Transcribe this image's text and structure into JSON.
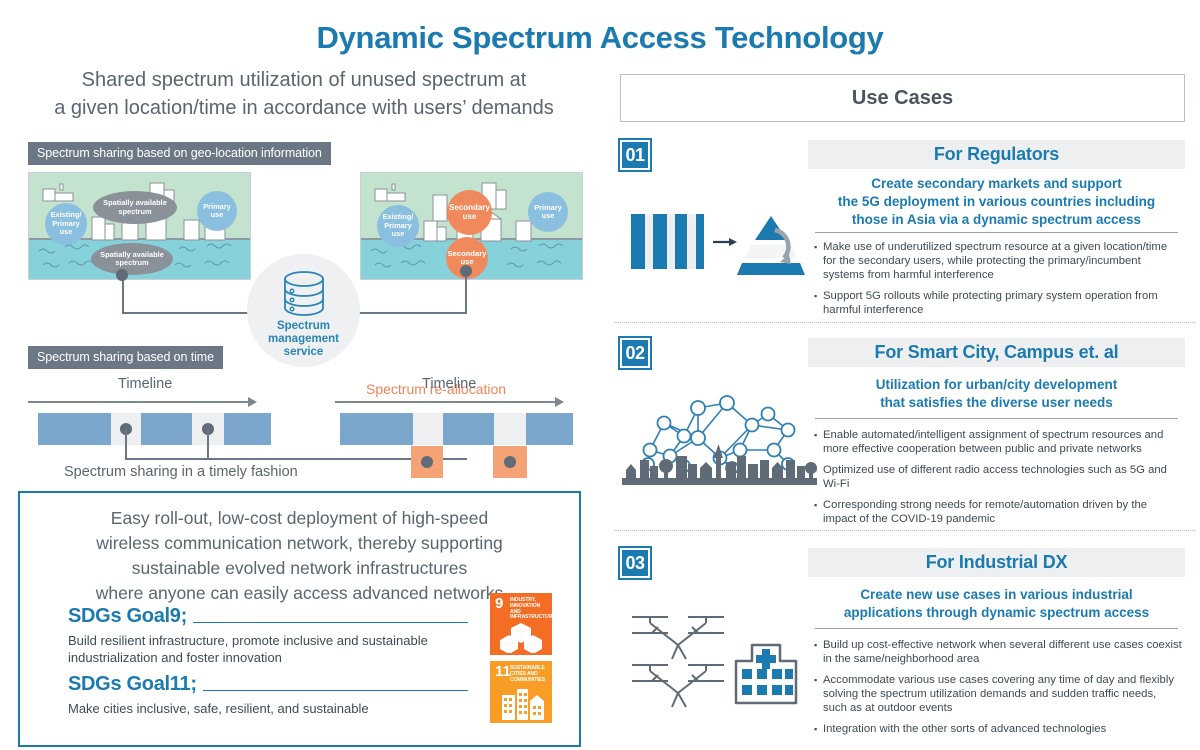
{
  "title": "Dynamic Spectrum Access Technology",
  "left": {
    "subtitle_line1": "Shared spectrum utilization of unused spectrum at",
    "subtitle_line2": "a given location/time in accordance with users’ demands",
    "tag_geo": "Spectrum sharing based on geo-location information",
    "tag_time": "Spectrum sharing based on time",
    "map_a": {
      "bubble_existing": "Existing/\nPrimary\nuse",
      "bubble_land": "Spatially available\nspectrum",
      "bubble_primary": "Primary\nuse",
      "bubble_sea": "Spatially available\nspectrum"
    },
    "map_b": {
      "bubble_existing": "Existing/\nPrimary\nuse",
      "bubble_land": "Secondary\nuse",
      "bubble_primary": "Primary\nuse",
      "bubble_sea": "Secondary\nuse"
    },
    "mgmt_service": "Spectrum\nmanagement\nservice",
    "reallocation_label": "Spectrum re-allocation",
    "timeline_left_label": "Timeline",
    "timeline_right_label": "Timeline",
    "timeline_caption": "Spectrum sharing in a timely fashion",
    "sdg": {
      "lead_line1": "Easy roll-out, low-cost deployment of high-speed",
      "lead_line2": "wireless communication network, thereby supporting",
      "lead_line3": "sustainable evolved network infrastructures",
      "lead_line4": "where anyone can easily access advanced networks",
      "goal9_title": "SDGs Goal9;",
      "goal9_desc": "Build resilient infrastructure, promote inclusive and sustainable industrialization and foster innovation",
      "goal11_title": "SDGs Goal11;",
      "goal11_desc": "Make cities inclusive, safe, resilient, and sustainable",
      "badge9_num": "9",
      "badge9_caption": "INDUSTRY, INNOVATION AND INFRASTRUCTURE",
      "badge11_num": "11",
      "badge11_caption": "SUSTAINABLE CITIES AND COMMUNITIES"
    }
  },
  "right": {
    "header": "Use Cases",
    "cases": [
      {
        "num": "01",
        "title": "For Regulators",
        "lead": "Create secondary markets and support\nthe 5G deployment in various countries including\nthose in Asia via a dynamic spectrum access",
        "bullets": [
          "Make use of underutilized spectrum resource at a given location/time for the secondary users, while protecting the primary/incumbent systems from harmful interference",
          "Support 5G rollouts while protecting primary system operation from harmful interference"
        ]
      },
      {
        "num": "02",
        "title": "For Smart City, Campus et. al",
        "lead": "Utilization for urban/city development\nthat satisfies the diverse user needs",
        "bullets": [
          "Enable automated/intelligent assignment of spectrum resources and more effective cooperation between public and private networks",
          "Optimized use of different radio access technologies such as 5G and Wi-Fi",
          "Corresponding strong needs for remote/automation driven by the impact of the COVID-19 pandemic"
        ]
      },
      {
        "num": "03",
        "title": "For Industrial DX",
        "lead": "Create new use cases in various industrial\napplications through dynamic spectrum access",
        "bullets": [
          "Build up cost-effective network when several different use cases coexist in the same/neighborhood area",
          "Accommodate various use cases covering any time of day and flexibly solving the spectrum utilization demands and sudden traffic needs, such as at outdoor events",
          "Integration with the other sorts of advanced technologies"
        ]
      }
    ]
  },
  "colors": {
    "brand_blue": "#1b7bb0",
    "accent_orange": "#f0855a",
    "slot_blue": "#7ba7cd",
    "land_green": "#c4e3cf",
    "sea_blue": "#87d2da",
    "tag_gray": "#6b7785",
    "sdg9_orange": "#f36d25",
    "sdg11_yellow": "#f99d26"
  },
  "icons": {
    "case1": "spectrum-bars-to-pyramid-icon",
    "case2": "city-mesh-network-icon",
    "case3": "drones-and-hospital-icon",
    "mgmt": "database-stack-icon"
  }
}
